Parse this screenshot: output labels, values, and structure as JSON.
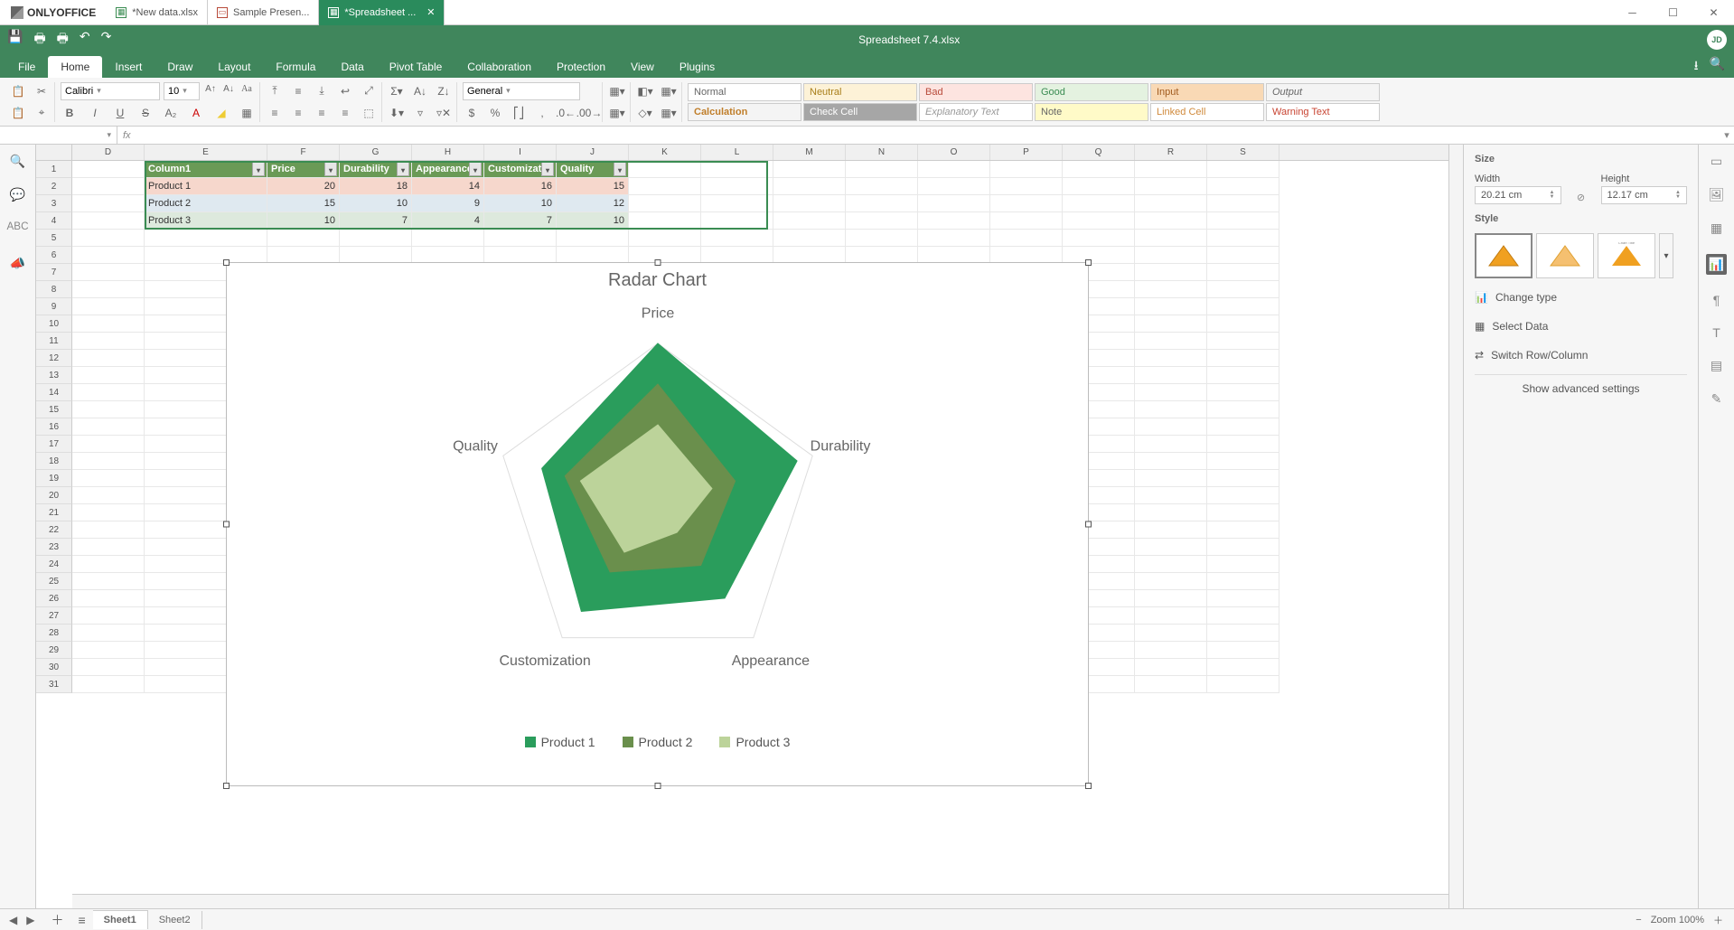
{
  "app": {
    "brand": "ONLYOFFICE",
    "user_initials": "JD"
  },
  "doc_tabs": [
    {
      "label": "*New data.xlsx",
      "icon_color": "#3a8c52"
    },
    {
      "label": "Sample Presen...",
      "icon_color": "#b84a3a"
    },
    {
      "label": "*Spreadsheet ...",
      "icon_color": "#fff",
      "active": true
    }
  ],
  "document_title": "Spreadsheet 7.4.xlsx",
  "menu_tabs": [
    "File",
    "Home",
    "Insert",
    "Draw",
    "Layout",
    "Formula",
    "Data",
    "Pivot Table",
    "Collaboration",
    "Protection",
    "View",
    "Plugins"
  ],
  "active_menu_tab": "Home",
  "font": {
    "name": "Calibri",
    "size": "10"
  },
  "number_format": "General",
  "cell_styles": {
    "normal": "Normal",
    "neutral": "Neutral",
    "bad": "Bad",
    "good": "Good",
    "input": "Input",
    "output": "Output",
    "calc": "Calculation",
    "checkcell": "Check Cell",
    "explan": "Explanatory Text",
    "note": "Note",
    "linked": "Linked Cell",
    "warn": "Warning Text"
  },
  "reference_box": {
    "name": "",
    "formula": ""
  },
  "columns": [
    "D",
    "E",
    "F",
    "G",
    "H",
    "I",
    "J",
    "K",
    "L",
    "M",
    "N",
    "O",
    "P",
    "Q",
    "R",
    "S"
  ],
  "selected_col_range": [
    "E",
    "F",
    "G",
    "H",
    "I",
    "J"
  ],
  "row_count": 31,
  "table_headers": [
    "Column1",
    "Price",
    "Durability",
    "Appearance",
    "Customizati",
    "Quality"
  ],
  "table_rows": [
    {
      "label": "Product 1",
      "values": [
        20,
        18,
        14,
        16,
        15
      ]
    },
    {
      "label": "Product 2",
      "values": [
        15,
        10,
        9,
        10,
        12
      ]
    },
    {
      "label": "Product 3",
      "values": [
        10,
        7,
        4,
        7,
        10
      ]
    }
  ],
  "chart": {
    "title": "Radar Chart",
    "axis_labels": [
      "Price",
      "Durability",
      "Appearance",
      "Customization",
      "Quality"
    ],
    "legend": [
      {
        "name": "Product 1",
        "color": "#2a9d5c"
      },
      {
        "name": "Product 2",
        "color": "#6a8f4c"
      },
      {
        "name": "Product 3",
        "color": "#bcd39a"
      }
    ]
  },
  "chart_data": {
    "type": "radar",
    "title": "Radar Chart",
    "categories": [
      "Price",
      "Durability",
      "Appearance",
      "Customization",
      "Quality"
    ],
    "series": [
      {
        "name": "Product 1",
        "color": "#2a9d5c",
        "values": [
          20,
          18,
          14,
          16,
          15
        ]
      },
      {
        "name": "Product 2",
        "color": "#6a8f4c",
        "values": [
          15,
          10,
          9,
          10,
          12
        ]
      },
      {
        "name": "Product 3",
        "color": "#bcd39a",
        "values": [
          10,
          7,
          4,
          7,
          10
        ]
      }
    ],
    "rlim": [
      0,
      20
    ]
  },
  "right_panel": {
    "size_label": "Size",
    "width_label": "Width",
    "height_label": "Height",
    "width_value": "20.21 cm",
    "height_value": "12.17 cm",
    "style_label": "Style",
    "change_type": "Change type",
    "select_data": "Select Data",
    "switch": "Switch Row/Column",
    "advanced": "Show advanced settings"
  },
  "sheet_tabs": {
    "active": "Sheet1",
    "items": [
      "Sheet1",
      "Sheet2"
    ]
  },
  "status": {
    "zoom_label": "Zoom 100%"
  }
}
